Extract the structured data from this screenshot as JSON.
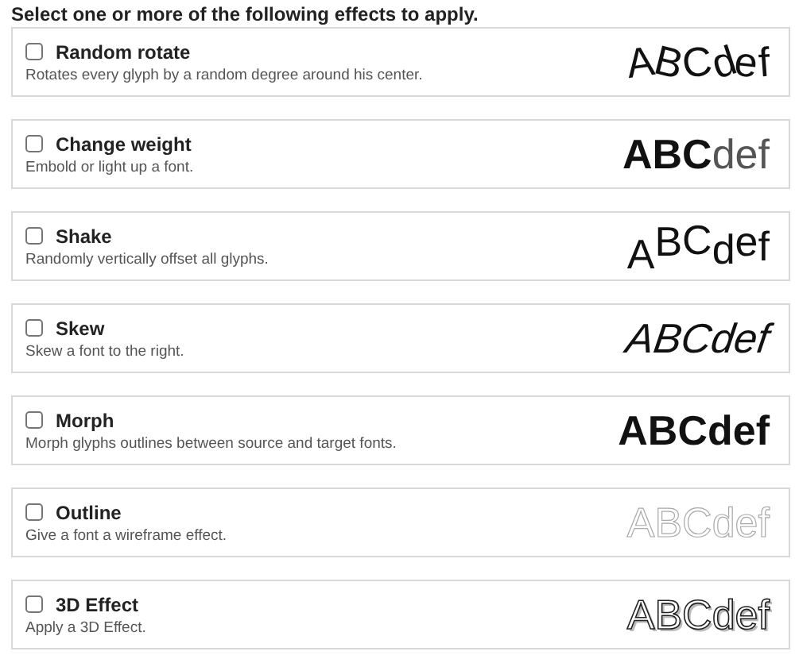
{
  "heading": "Select one or more of the following effects to apply.",
  "effects": [
    {
      "kind": "rotate",
      "title": "Random rotate",
      "description": "Rotates every glyph by a random degree around his center.",
      "checked": false,
      "sample": "ABCdef"
    },
    {
      "kind": "weight",
      "title": "Change weight",
      "description": "Embold or light up a font.",
      "checked": false,
      "sample": "ABCdef"
    },
    {
      "kind": "shake",
      "title": "Shake",
      "description": "Randomly vertically offset all glyphs.",
      "checked": false,
      "sample": "ABCdef"
    },
    {
      "kind": "skew",
      "title": "Skew",
      "description": "Skew a font to the right.",
      "checked": false,
      "sample": "ABCdef"
    },
    {
      "kind": "morph",
      "title": "Morph",
      "description": "Morph glyphs outlines between source and target fonts.",
      "checked": false,
      "sample": "ABCdef"
    },
    {
      "kind": "outline",
      "title": "Outline",
      "description": "Give a font a wireframe effect.",
      "checked": false,
      "sample": "ABCdef"
    },
    {
      "kind": "extrude",
      "title": "3D Effect",
      "description": "Apply a 3D Effect.",
      "checked": false,
      "sample": "ABCdef"
    }
  ]
}
